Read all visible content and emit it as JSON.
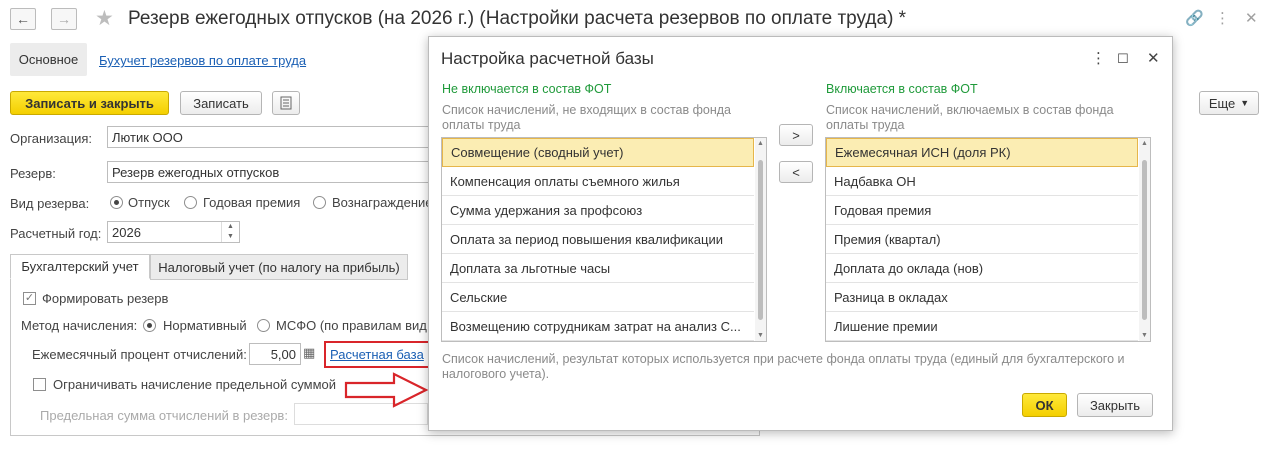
{
  "window": {
    "title": "Резерв ежегодных отпусков (на 2026 г.) (Настройки расчета резервов по оплате труда) *",
    "nav_back": "←",
    "nav_forward": "→"
  },
  "tabs_top": {
    "main": "Основное",
    "link": "Бухучет резервов по оплате труда"
  },
  "toolbar": {
    "save_close": "Записать и закрыть",
    "save": "Записать",
    "more": "Еще"
  },
  "form": {
    "org_label": "Организация:",
    "org_value": "Лютик ООО",
    "reserve_label": "Резерв:",
    "reserve_value": "Резерв ежегодных отпусков",
    "type_label": "Вид резерва:",
    "type_options": [
      "Отпуск",
      "Годовая премия",
      "Вознаграждение"
    ],
    "type_selected": "Отпуск",
    "year_label": "Расчетный год:",
    "year_value": "2026"
  },
  "subtabs": [
    "Бухгалтерский учет",
    "Налоговый учет (по налогу на прибыль)"
  ],
  "accounting": {
    "form_reserve": "Формировать резерв",
    "method_label": "Метод начисления:",
    "method_options": [
      "Нормативный",
      "МСФО (по правилам вид"
    ],
    "monthly_label": "Ежемесячный процент отчислений:",
    "monthly_value": "5,00",
    "base_link": "Расчетная база",
    "limit_label": "Ограничивать начисление предельной суммой",
    "limit_sum_label": "Предельная сумма отчислений в резерв:"
  },
  "dialog": {
    "title": "Настройка расчетной базы",
    "left_header": "Не включается в состав ФОТ",
    "left_desc": "Список начислений, не входящих в состав фонда оплаты труда",
    "right_header": "Включается в состав ФОТ",
    "right_desc": "Список начислений, включаемых в состав фонда оплаты труда",
    "move_right": ">",
    "move_left": "<",
    "left_items": [
      "Совмещение (сводный учет)",
      "Компенсация оплаты съемного жилья",
      "Сумма удержания за профсоюз",
      "Оплата за период повышения квалификации",
      "Доплата за льготные часы",
      "Сельские",
      "Возмещению сотрудникам затрат на анализ С..."
    ],
    "right_items": [
      "Ежемесячная ИСН (доля РК)",
      "Надбавка ОН",
      "Годовая премия",
      "Премия (квартал)",
      "Доплата до оклада (нов)",
      "Разница в окладах",
      "Лишение премии"
    ],
    "footer_note": "Список начислений, результат которых используется при расчете фонда оплаты труда (единый для бухгалтерского и налогового учета).",
    "ok": "ОК",
    "close": "Закрыть"
  },
  "colors": {
    "accent_yellow": "#f5d10b",
    "link_blue": "#1a5fb4",
    "header_green": "#1f9a3a",
    "highlight_red": "#d9252a"
  }
}
